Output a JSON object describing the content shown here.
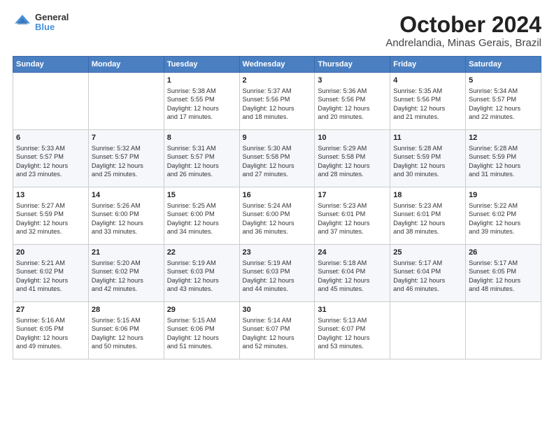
{
  "header": {
    "logo_line1": "General",
    "logo_line2": "Blue",
    "title": "October 2024",
    "subtitle": "Andrelandia, Minas Gerais, Brazil"
  },
  "weekdays": [
    "Sunday",
    "Monday",
    "Tuesday",
    "Wednesday",
    "Thursday",
    "Friday",
    "Saturday"
  ],
  "weeks": [
    [
      {
        "day": "",
        "detail": ""
      },
      {
        "day": "",
        "detail": ""
      },
      {
        "day": "1",
        "detail": "Sunrise: 5:38 AM\nSunset: 5:55 PM\nDaylight: 12 hours\nand 17 minutes."
      },
      {
        "day": "2",
        "detail": "Sunrise: 5:37 AM\nSunset: 5:56 PM\nDaylight: 12 hours\nand 18 minutes."
      },
      {
        "day": "3",
        "detail": "Sunrise: 5:36 AM\nSunset: 5:56 PM\nDaylight: 12 hours\nand 20 minutes."
      },
      {
        "day": "4",
        "detail": "Sunrise: 5:35 AM\nSunset: 5:56 PM\nDaylight: 12 hours\nand 21 minutes."
      },
      {
        "day": "5",
        "detail": "Sunrise: 5:34 AM\nSunset: 5:57 PM\nDaylight: 12 hours\nand 22 minutes."
      }
    ],
    [
      {
        "day": "6",
        "detail": "Sunrise: 5:33 AM\nSunset: 5:57 PM\nDaylight: 12 hours\nand 23 minutes."
      },
      {
        "day": "7",
        "detail": "Sunrise: 5:32 AM\nSunset: 5:57 PM\nDaylight: 12 hours\nand 25 minutes."
      },
      {
        "day": "8",
        "detail": "Sunrise: 5:31 AM\nSunset: 5:57 PM\nDaylight: 12 hours\nand 26 minutes."
      },
      {
        "day": "9",
        "detail": "Sunrise: 5:30 AM\nSunset: 5:58 PM\nDaylight: 12 hours\nand 27 minutes."
      },
      {
        "day": "10",
        "detail": "Sunrise: 5:29 AM\nSunset: 5:58 PM\nDaylight: 12 hours\nand 28 minutes."
      },
      {
        "day": "11",
        "detail": "Sunrise: 5:28 AM\nSunset: 5:59 PM\nDaylight: 12 hours\nand 30 minutes."
      },
      {
        "day": "12",
        "detail": "Sunrise: 5:28 AM\nSunset: 5:59 PM\nDaylight: 12 hours\nand 31 minutes."
      }
    ],
    [
      {
        "day": "13",
        "detail": "Sunrise: 5:27 AM\nSunset: 5:59 PM\nDaylight: 12 hours\nand 32 minutes."
      },
      {
        "day": "14",
        "detail": "Sunrise: 5:26 AM\nSunset: 6:00 PM\nDaylight: 12 hours\nand 33 minutes."
      },
      {
        "day": "15",
        "detail": "Sunrise: 5:25 AM\nSunset: 6:00 PM\nDaylight: 12 hours\nand 34 minutes."
      },
      {
        "day": "16",
        "detail": "Sunrise: 5:24 AM\nSunset: 6:00 PM\nDaylight: 12 hours\nand 36 minutes."
      },
      {
        "day": "17",
        "detail": "Sunrise: 5:23 AM\nSunset: 6:01 PM\nDaylight: 12 hours\nand 37 minutes."
      },
      {
        "day": "18",
        "detail": "Sunrise: 5:23 AM\nSunset: 6:01 PM\nDaylight: 12 hours\nand 38 minutes."
      },
      {
        "day": "19",
        "detail": "Sunrise: 5:22 AM\nSunset: 6:02 PM\nDaylight: 12 hours\nand 39 minutes."
      }
    ],
    [
      {
        "day": "20",
        "detail": "Sunrise: 5:21 AM\nSunset: 6:02 PM\nDaylight: 12 hours\nand 41 minutes."
      },
      {
        "day": "21",
        "detail": "Sunrise: 5:20 AM\nSunset: 6:02 PM\nDaylight: 12 hours\nand 42 minutes."
      },
      {
        "day": "22",
        "detail": "Sunrise: 5:19 AM\nSunset: 6:03 PM\nDaylight: 12 hours\nand 43 minutes."
      },
      {
        "day": "23",
        "detail": "Sunrise: 5:19 AM\nSunset: 6:03 PM\nDaylight: 12 hours\nand 44 minutes."
      },
      {
        "day": "24",
        "detail": "Sunrise: 5:18 AM\nSunset: 6:04 PM\nDaylight: 12 hours\nand 45 minutes."
      },
      {
        "day": "25",
        "detail": "Sunrise: 5:17 AM\nSunset: 6:04 PM\nDaylight: 12 hours\nand 46 minutes."
      },
      {
        "day": "26",
        "detail": "Sunrise: 5:17 AM\nSunset: 6:05 PM\nDaylight: 12 hours\nand 48 minutes."
      }
    ],
    [
      {
        "day": "27",
        "detail": "Sunrise: 5:16 AM\nSunset: 6:05 PM\nDaylight: 12 hours\nand 49 minutes."
      },
      {
        "day": "28",
        "detail": "Sunrise: 5:15 AM\nSunset: 6:06 PM\nDaylight: 12 hours\nand 50 minutes."
      },
      {
        "day": "29",
        "detail": "Sunrise: 5:15 AM\nSunset: 6:06 PM\nDaylight: 12 hours\nand 51 minutes."
      },
      {
        "day": "30",
        "detail": "Sunrise: 5:14 AM\nSunset: 6:07 PM\nDaylight: 12 hours\nand 52 minutes."
      },
      {
        "day": "31",
        "detail": "Sunrise: 5:13 AM\nSunset: 6:07 PM\nDaylight: 12 hours\nand 53 minutes."
      },
      {
        "day": "",
        "detail": ""
      },
      {
        "day": "",
        "detail": ""
      }
    ]
  ]
}
